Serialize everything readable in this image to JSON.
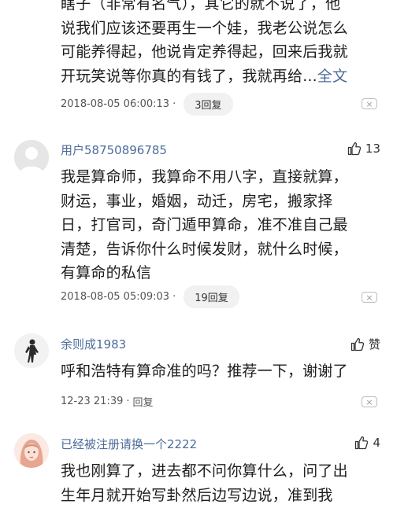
{
  "comments": [
    {
      "body_lines": [
        "瞎子（非常有名气），其它的就不说了，他",
        "说我们应该还要再生一个娃，我老公说怎么",
        "可能养得起，他说肯定养得起，回来后我就",
        "开玩笑说等你真的有钱了，我就再给..."
      ],
      "more_label": "全文",
      "time": "2018-08-05 06:00:13",
      "separator": "·",
      "reply_label": "3回复",
      "close_label": "×"
    },
    {
      "username": "用户58750896785",
      "likes": "13",
      "body_lines": [
        "我是算命师，我算命不用八字，直接就算，",
        "财运，事业，婚姻，动迁，房宅，搬家择",
        "日，打官司，奇门遁甲算命，准不准自己最",
        "清楚，告诉你什么时候发财，就什么时候，",
        "有算命的私信"
      ],
      "time": "2018-08-05 05:09:03",
      "separator": "·",
      "reply_label": "19回复",
      "close_label": "×"
    },
    {
      "username": "余则成1983",
      "likes": "赞",
      "body_lines": [
        "呼和浩特有算命准的吗？推荐一下，谢谢了"
      ],
      "time": "12-23 21:39",
      "separator": "·",
      "reply_label": "回复",
      "close_label": "×"
    },
    {
      "username": "已经被注册请换一个2222",
      "likes": "4",
      "body_lines": [
        "我也刚算了，进去都不问你算什么，问了出",
        "生年月就开始写卦然后边写边说，准到我"
      ]
    }
  ],
  "icons": {
    "like": "thumbs-up-icon",
    "close": "close-icon"
  },
  "colors": {
    "username": "#4c6c9a",
    "more_link": "#4c6c9a",
    "reply_pill_bg": "#f1f1f1"
  }
}
